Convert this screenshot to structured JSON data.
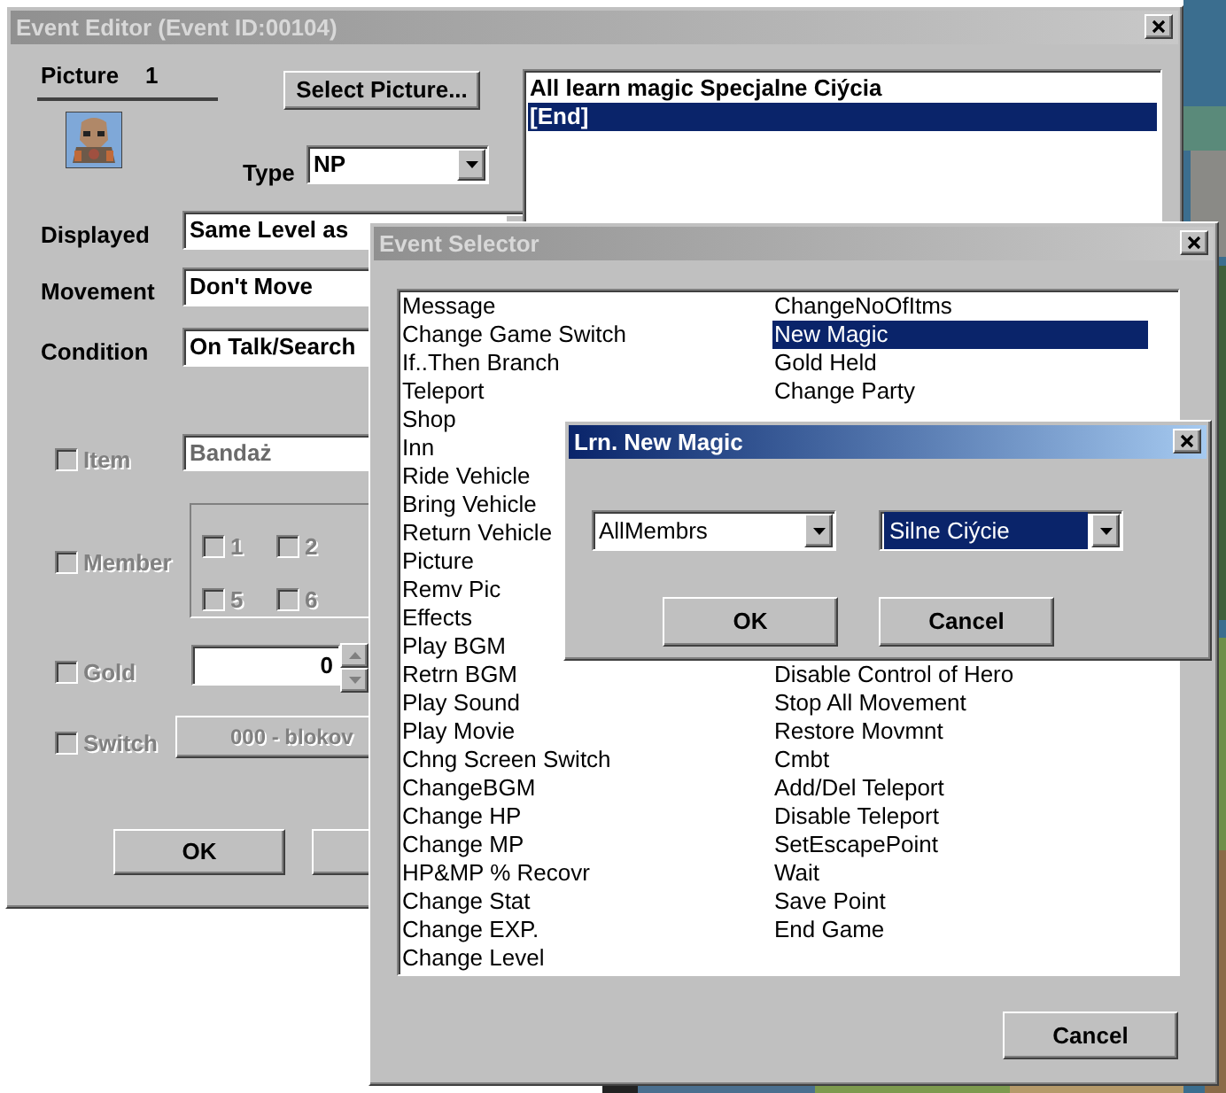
{
  "event_editor": {
    "title": "Event Editor (Event ID:00104)",
    "active": false,
    "picture_label": "Picture",
    "picture_number": "1",
    "select_picture_button": "Select Picture...",
    "type": {
      "label": "Type",
      "value": "NP"
    },
    "fields": [
      {
        "label": "Displayed",
        "value": "Same Level as"
      },
      {
        "label": "Movement",
        "value": "Don't Move"
      },
      {
        "label": "Condition",
        "value": "On Talk/Search"
      }
    ],
    "conditions": [
      {
        "kind": "field",
        "label": "Item",
        "checked": false,
        "disabled": true,
        "value": "Bandaż"
      },
      {
        "kind": "members",
        "label": "Member",
        "checked": false,
        "disabled": true,
        "members": [
          {
            "label": "1",
            "checked": false
          },
          {
            "label": "2",
            "checked": false
          },
          {
            "label": "5",
            "checked": false
          },
          {
            "label": "6",
            "checked": false
          }
        ]
      },
      {
        "kind": "number",
        "label": "Gold",
        "checked": false,
        "disabled": true,
        "value": "0"
      },
      {
        "kind": "button",
        "label": "Switch",
        "checked": false,
        "disabled": true,
        "value": "000 - blokov"
      }
    ],
    "ok_button": "OK",
    "event_list": [
      {
        "text": "All learn magic Specjalne Ciýcia",
        "selected": false
      },
      {
        "text": "[End]",
        "selected": true
      }
    ]
  },
  "event_selector": {
    "title": "Event Selector",
    "active": false,
    "commands_left": [
      {
        "text": "Message",
        "selected": false
      },
      {
        "text": "Change Game Switch",
        "selected": false
      },
      {
        "text": "If..Then Branch",
        "selected": false
      },
      {
        "text": "Teleport",
        "selected": false
      },
      {
        "text": "Shop",
        "selected": false
      },
      {
        "text": "Inn",
        "selected": false
      },
      {
        "text": "Ride Vehicle",
        "selected": false
      },
      {
        "text": "Bring Vehicle",
        "selected": false
      },
      {
        "text": "Return Vehicle",
        "selected": false
      },
      {
        "text": "Picture",
        "selected": false
      },
      {
        "text": "Remv Pic",
        "selected": false
      },
      {
        "text": "Effects",
        "selected": false
      },
      {
        "text": "Play BGM",
        "selected": false
      },
      {
        "text": "Retrn BGM",
        "selected": false
      },
      {
        "text": "Play Sound",
        "selected": false
      },
      {
        "text": "Play Movie",
        "selected": false
      },
      {
        "text": "Chng Screen Switch",
        "selected": false
      },
      {
        "text": "ChangeBGM",
        "selected": false
      },
      {
        "text": "Change HP",
        "selected": false
      },
      {
        "text": "Change MP",
        "selected": false
      },
      {
        "text": "HP&MP % Recovr",
        "selected": false
      },
      {
        "text": "Change Stat",
        "selected": false
      },
      {
        "text": "Change EXP.",
        "selected": false
      },
      {
        "text": "Change Level",
        "selected": false
      }
    ],
    "commands_right_top": [
      {
        "text": "ChangeNoOfItms",
        "selected": false
      },
      {
        "text": "New Magic",
        "selected": true
      },
      {
        "text": "Gold Held",
        "selected": false
      },
      {
        "text": "Change Party",
        "selected": false
      }
    ],
    "commands_right_bottom": [
      {
        "text": "Disable Control of Hero",
        "selected": false
      },
      {
        "text": "Stop All Movement",
        "selected": false
      },
      {
        "text": "Restore Movmnt",
        "selected": false
      },
      {
        "text": "Cmbt",
        "selected": false
      },
      {
        "text": "Add/Del Teleport",
        "selected": false
      },
      {
        "text": "Disable Teleport",
        "selected": false
      },
      {
        "text": "SetEscapePoint",
        "selected": false
      },
      {
        "text": "Wait",
        "selected": false
      },
      {
        "text": "Save Point",
        "selected": false
      },
      {
        "text": "End Game",
        "selected": false
      }
    ],
    "cancel_button": "Cancel"
  },
  "dialog": {
    "title": "Lrn. New Magic",
    "active": true,
    "target": {
      "value": "AllMembrs",
      "selected": false
    },
    "magic": {
      "value": "Silne Ciýcie",
      "selected": true
    },
    "ok_button": "OK",
    "cancel_button": "Cancel"
  }
}
